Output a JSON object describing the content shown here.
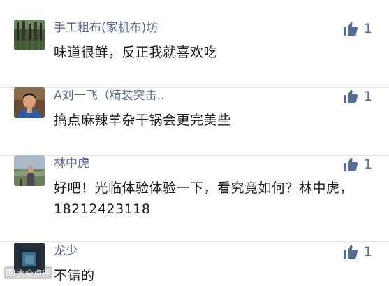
{
  "comments": [
    {
      "nickname": "手工粗布(家机布)坊",
      "content": "味道很鲜，反正我就喜欢吃",
      "likes": "1",
      "avatar": "forest-avatar"
    },
    {
      "nickname": "A刘一飞（精装突击..",
      "content": "搞点麻辣羊杂干锅会更完美些",
      "likes": "1",
      "avatar": "man-avatar"
    },
    {
      "nickname": "林中虎",
      "content": "好吧！光临体验体验一下，看究竟如何？林中虎，18212423118",
      "likes": "1",
      "avatar": "outdoor-person-avatar"
    },
    {
      "nickname": "龙少",
      "content": "不错的",
      "likes": "1",
      "avatar": "dark-avatar"
    }
  ],
  "watermark": {
    "text": "大众点评",
    "icon": "camera-icon"
  },
  "colors": {
    "nickname": "#576b95",
    "like": "#576b95",
    "text": "#1a1a1a"
  }
}
